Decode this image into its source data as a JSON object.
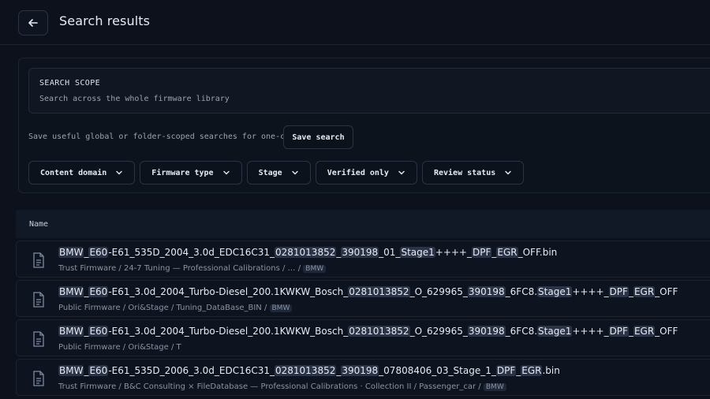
{
  "header": {
    "title": "Search results"
  },
  "scope": {
    "heading": "SEARCH SCOPE",
    "description": "Search across the whole firmware library"
  },
  "save": {
    "hint": "Save useful global or folder-scoped searches for one-click reuse.",
    "button_label": "Save search"
  },
  "filters": [
    {
      "label": "Content domain"
    },
    {
      "label": "Firmware type"
    },
    {
      "label": "Stage"
    },
    {
      "label": "Verified only"
    },
    {
      "label": "Review status"
    }
  ],
  "results": {
    "column_name": "Name",
    "rows": [
      {
        "name_parts": [
          {
            "t": "BMW",
            "hl": true
          },
          {
            "t": "_"
          },
          {
            "t": "E60",
            "hl": true
          },
          {
            "t": "-E61_535D_2004_3.0d_EDC16C31_"
          },
          {
            "t": "0281013852",
            "hl": true
          },
          {
            "t": "_"
          },
          {
            "t": "390198",
            "hl": true
          },
          {
            "t": "_01_"
          },
          {
            "t": "Stage1",
            "hl": true
          },
          {
            "t": "++++_"
          },
          {
            "t": "DPF",
            "hl": true
          },
          {
            "t": "_"
          },
          {
            "t": "EGR",
            "hl": true
          },
          {
            "t": "_OFF.bin"
          }
        ],
        "path": "Trust Firmware  /  24-7 Tuning — Professional Calibrations  /  …  /",
        "tag": "BMW"
      },
      {
        "name_parts": [
          {
            "t": "BMW",
            "hl": true
          },
          {
            "t": "_"
          },
          {
            "t": "E60",
            "hl": true
          },
          {
            "t": "-E61_3.0d_2004_Turbo-Diesel_200.1KWKW_Bosch_"
          },
          {
            "t": "0281013852",
            "hl": true
          },
          {
            "t": "_O_629965_"
          },
          {
            "t": "390198",
            "hl": true
          },
          {
            "t": "_6FC8."
          },
          {
            "t": "Stage1",
            "hl": true
          },
          {
            "t": "++++_"
          },
          {
            "t": "DPF",
            "hl": true
          },
          {
            "t": "_"
          },
          {
            "t": "EGR",
            "hl": true
          },
          {
            "t": "_OFF"
          }
        ],
        "path": "Public Firmware  /  Ori&Stage  /  Tuning_DataBase_BIN  /",
        "tag": "BMW"
      },
      {
        "name_parts": [
          {
            "t": "BMW",
            "hl": true
          },
          {
            "t": "_"
          },
          {
            "t": "E60",
            "hl": true
          },
          {
            "t": "-E61_3.0d_2004_Turbo-Diesel_200.1KWKW_Bosch_"
          },
          {
            "t": "0281013852",
            "hl": true
          },
          {
            "t": "_O_629965_"
          },
          {
            "t": "390198",
            "hl": true
          },
          {
            "t": "_6FC8."
          },
          {
            "t": "Stage1",
            "hl": true
          },
          {
            "t": "++++_"
          },
          {
            "t": "DPF",
            "hl": true
          },
          {
            "t": "_"
          },
          {
            "t": "EGR",
            "hl": true
          },
          {
            "t": "_OFF"
          }
        ],
        "path": "Public Firmware  /  Ori&Stage  /  T",
        "tag": ""
      },
      {
        "name_parts": [
          {
            "t": "BMW",
            "hl": true
          },
          {
            "t": "_"
          },
          {
            "t": "E60",
            "hl": true
          },
          {
            "t": "-E61_535D_2006_3.0d_EDC16C31_"
          },
          {
            "t": "0281013852",
            "hl": true
          },
          {
            "t": "_"
          },
          {
            "t": "390198",
            "hl": true
          },
          {
            "t": "_07808406_03_Stage_1_"
          },
          {
            "t": "DPF",
            "hl": true
          },
          {
            "t": "_"
          },
          {
            "t": "EGR",
            "hl": true
          },
          {
            "t": ".bin"
          }
        ],
        "path": "Trust Firmware  /  B&C Consulting × FileDatabase — Professional Calibrations · Collection II  /  Passenger_car  /",
        "tag": "BMW"
      }
    ]
  }
}
